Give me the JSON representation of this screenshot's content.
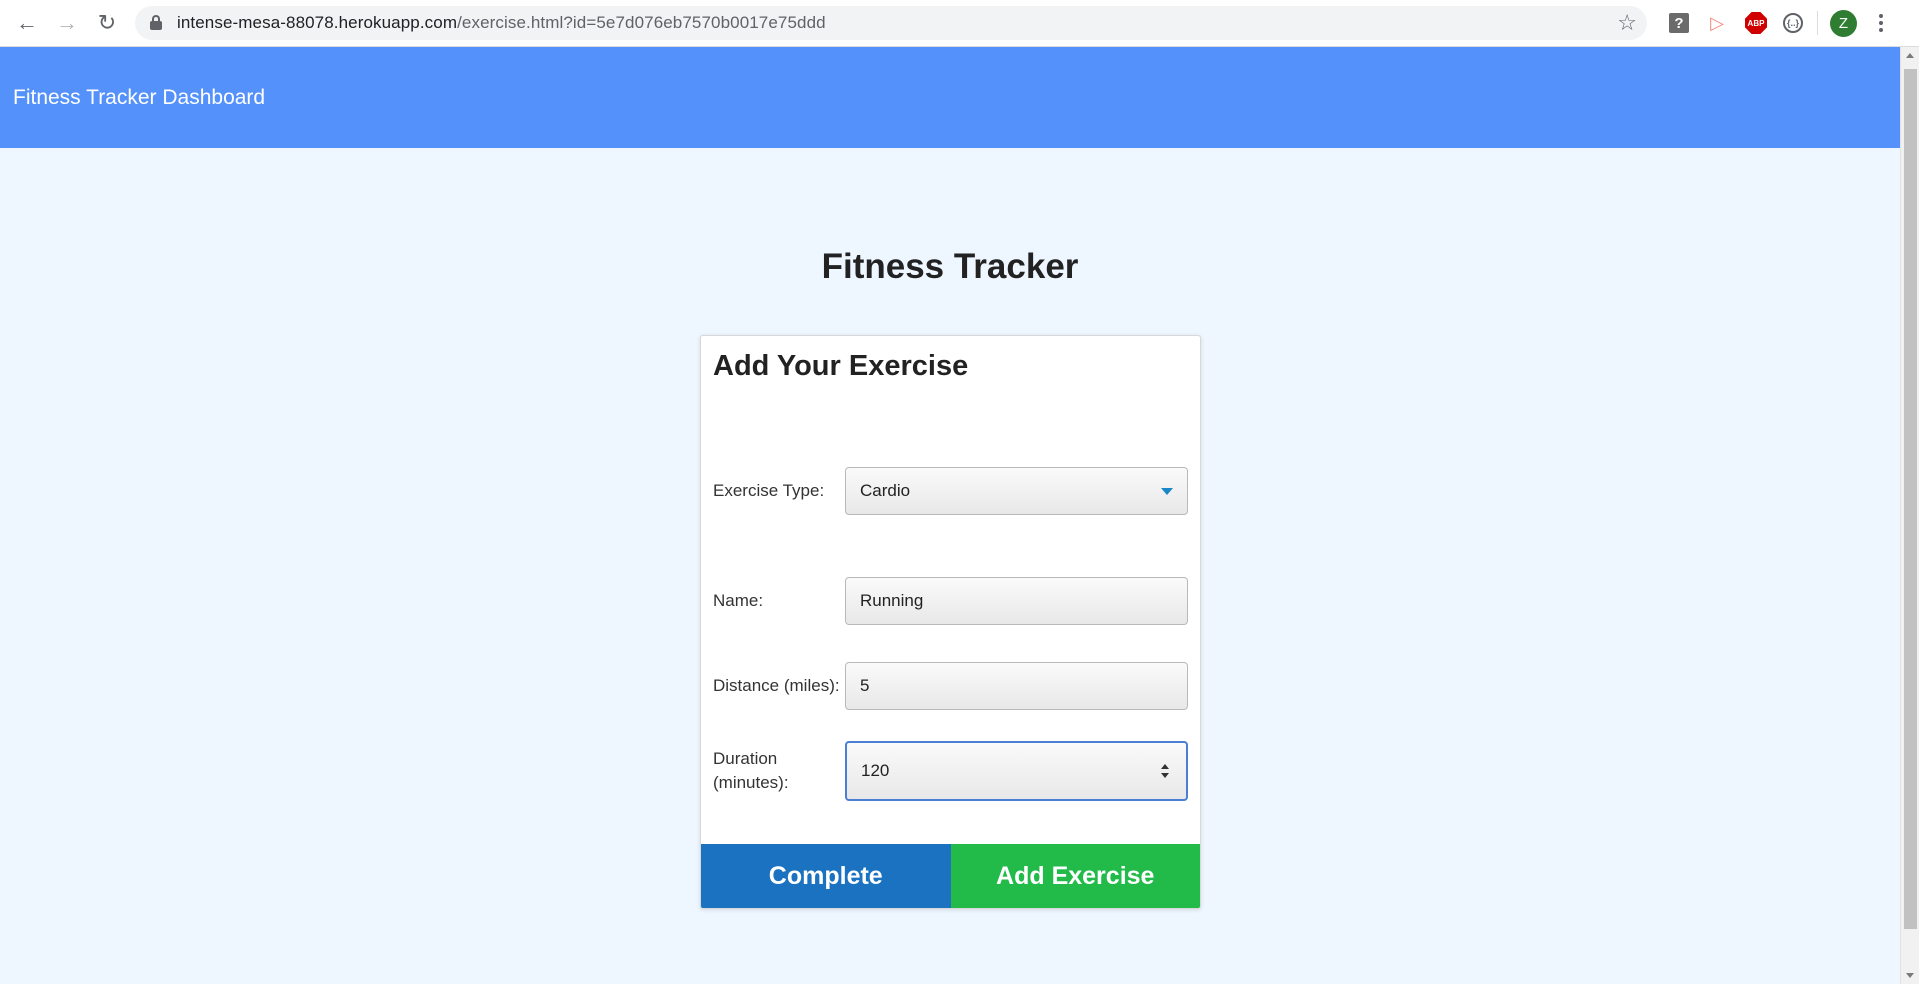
{
  "browser": {
    "url_host": "intense-mesa-88078.herokuapp.com",
    "url_path": "/exercise.html?id=5e7d076eb7570b0017e75ddd",
    "profile_initial": "Z",
    "icons": {
      "back": "arrow-left-icon",
      "forward": "arrow-right-icon",
      "reload": "reload-icon",
      "lock": "lock-icon",
      "bookmark": "star-icon",
      "menu": "kebab-menu-icon"
    },
    "extensions": {
      "help": "?",
      "abp": "ABP",
      "code": "{..}"
    }
  },
  "header": {
    "brand": "Fitness Tracker Dashboard",
    "color": "#5591fb"
  },
  "page": {
    "title": "Fitness Tracker",
    "background": "#eef6ff"
  },
  "form": {
    "title": "Add Your Exercise",
    "type": {
      "label": "Exercise Type:",
      "selected": "Cardio"
    },
    "name": {
      "label": "Name:",
      "value": "Running"
    },
    "distance": {
      "label": "Distance (miles):",
      "value": "5"
    },
    "duration": {
      "label_line1": "Duration",
      "label_line2": "(minutes):",
      "value": "120"
    }
  },
  "buttons": {
    "complete": {
      "label": "Complete",
      "color": "#1a72c0"
    },
    "add": {
      "label": "Add Exercise",
      "color": "#22bb4a"
    }
  }
}
